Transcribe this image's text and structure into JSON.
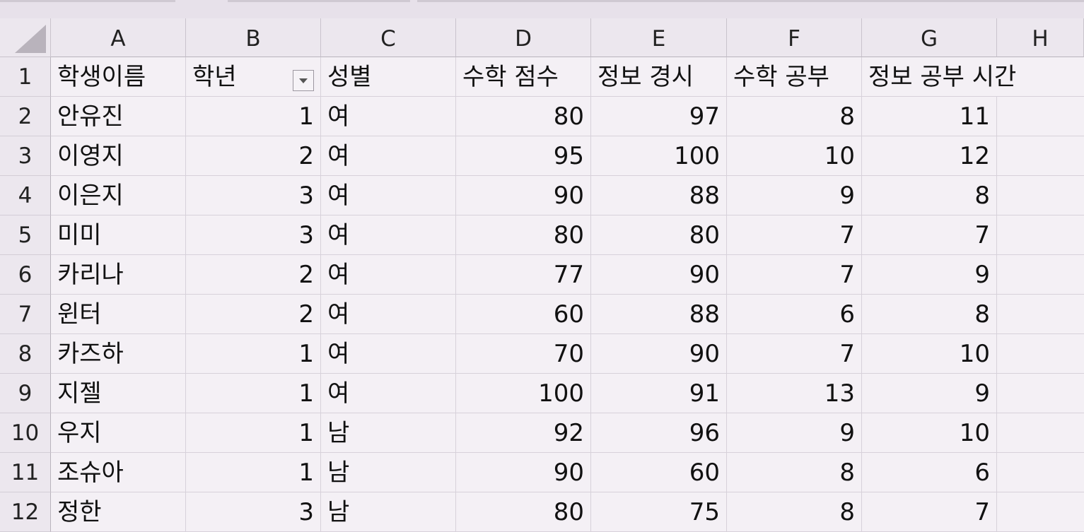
{
  "columns": [
    "A",
    "B",
    "C",
    "D",
    "E",
    "F",
    "G",
    "H"
  ],
  "headers": [
    "학생이름",
    "학년",
    "성별",
    "수학 점수",
    "정보 경시",
    "수학 공부 ",
    "정보 공부 시간"
  ],
  "rows": [
    {
      "num": "1"
    },
    {
      "num": "2",
      "cells": [
        "안유진",
        "1",
        "여",
        "80",
        "97",
        "8",
        "11"
      ]
    },
    {
      "num": "3",
      "cells": [
        "이영지",
        "2",
        "여",
        "95",
        "100",
        "10",
        "12"
      ]
    },
    {
      "num": "4",
      "cells": [
        "이은지",
        "3",
        "여",
        "90",
        "88",
        "9",
        "8"
      ]
    },
    {
      "num": "5",
      "cells": [
        "미미",
        "3",
        "여",
        "80",
        "80",
        "7",
        "7"
      ]
    },
    {
      "num": "6",
      "cells": [
        "카리나",
        "2",
        "여",
        "77",
        "90",
        "7",
        "9"
      ]
    },
    {
      "num": "7",
      "cells": [
        "윈터",
        "2",
        "여",
        "60",
        "88",
        "6",
        "8"
      ]
    },
    {
      "num": "8",
      "cells": [
        "카즈하",
        "1",
        "여",
        "70",
        "90",
        "7",
        "10"
      ]
    },
    {
      "num": "9",
      "cells": [
        "지젤",
        "1",
        "여",
        "100",
        "91",
        "13",
        "9"
      ]
    },
    {
      "num": "10",
      "cells": [
        "우지",
        "1",
        "남",
        "92",
        "96",
        "9",
        "10"
      ]
    },
    {
      "num": "11",
      "cells": [
        "조슈아",
        "1",
        "남",
        "90",
        "60",
        "8",
        "6"
      ]
    },
    {
      "num": "12",
      "cells": [
        "정한",
        "3",
        "남",
        "80",
        "75",
        "8",
        "7"
      ]
    }
  ]
}
